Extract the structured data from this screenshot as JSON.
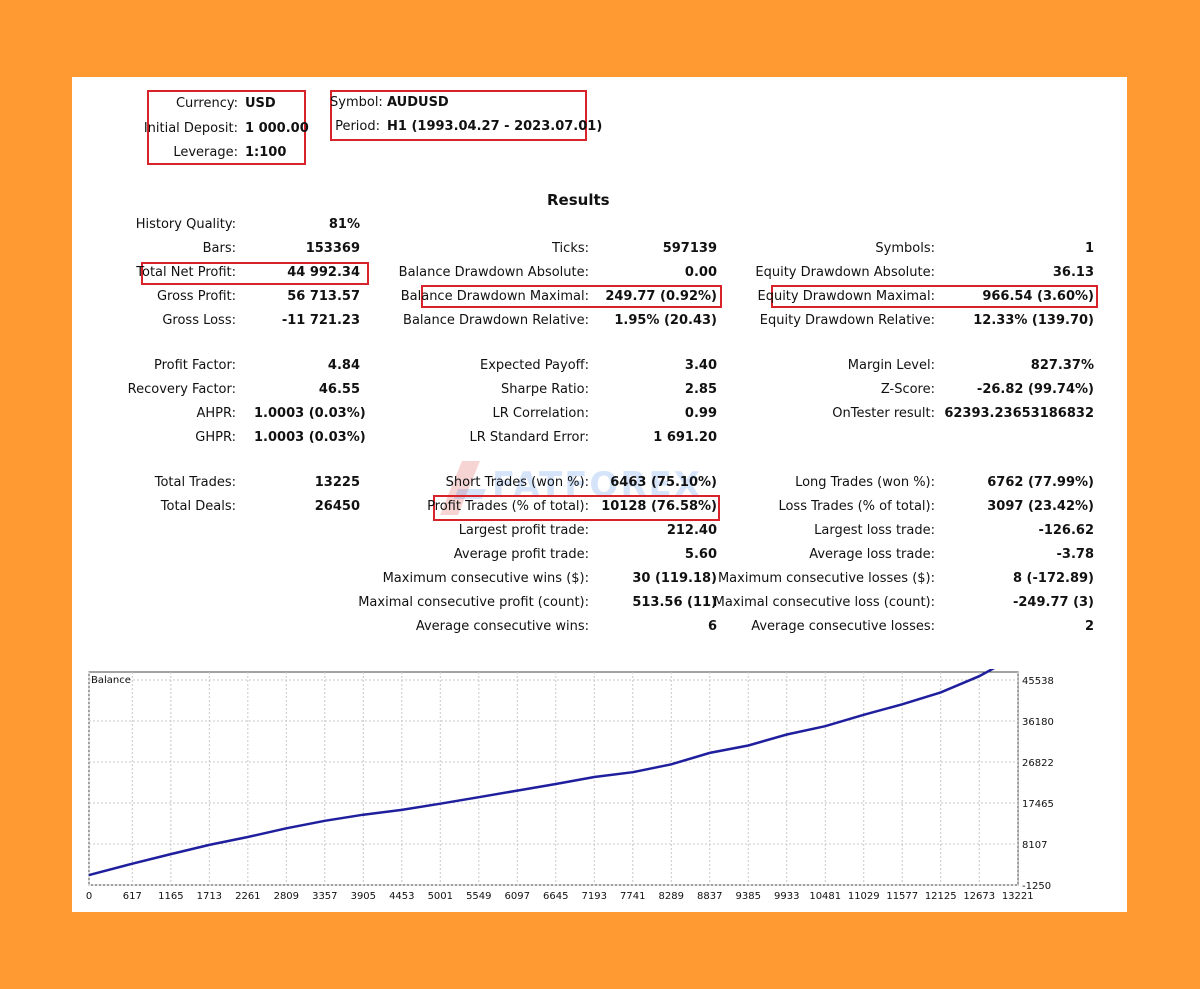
{
  "header": {
    "currency_label": "Currency:",
    "currency": "USD",
    "deposit_label": "Initial Deposit:",
    "deposit": "1 000.00",
    "leverage_label": "Leverage:",
    "leverage": "1:100",
    "symbol_label": "Symbol:",
    "symbol": "AUDUSD",
    "period_label": "Period:",
    "period": "H1 (1993.04.27 - 2023.07.01)"
  },
  "results_title": "Results",
  "col1": [
    {
      "label": "History Quality:",
      "value": "81%"
    },
    {
      "label": "Bars:",
      "value": "153369"
    },
    {
      "label": "Total Net Profit:",
      "value": "44 992.34"
    },
    {
      "label": "Gross Profit:",
      "value": "56 713.57"
    },
    {
      "label": "Gross Loss:",
      "value": "-11 721.23"
    },
    {
      "label": "Profit Factor:",
      "value": "4.84"
    },
    {
      "label": "Recovery Factor:",
      "value": "46.55"
    },
    {
      "label": "AHPR:",
      "value": "1.0003 (0.03%)"
    },
    {
      "label": "GHPR:",
      "value": "1.0003 (0.03%)"
    },
    {
      "label": "Total Trades:",
      "value": "13225"
    },
    {
      "label": "Total Deals:",
      "value": "26450"
    }
  ],
  "col2": [
    {
      "label": "Ticks:",
      "value": "597139"
    },
    {
      "label": "Balance Drawdown Absolute:",
      "value": "0.00"
    },
    {
      "label": "Balance Drawdown Maximal:",
      "value": "249.77 (0.92%)"
    },
    {
      "label": "Balance Drawdown Relative:",
      "value": "1.95% (20.43)"
    },
    {
      "label": "Expected Payoff:",
      "value": "3.40"
    },
    {
      "label": "Sharpe Ratio:",
      "value": "2.85"
    },
    {
      "label": "LR Correlation:",
      "value": "0.99"
    },
    {
      "label": "LR Standard Error:",
      "value": "1 691.20"
    },
    {
      "label": "Short Trades (won %):",
      "value": "6463 (75.10%)"
    },
    {
      "label": "Profit Trades (% of total):",
      "value": "10128 (76.58%)"
    },
    {
      "label": "Largest profit trade:",
      "value": "212.40"
    },
    {
      "label": "Average profit trade:",
      "value": "5.60"
    },
    {
      "label": "Maximum consecutive wins ($):",
      "value": "30 (119.18)"
    },
    {
      "label": "Maximal consecutive profit (count):",
      "value": "513.56 (11)"
    },
    {
      "label": "Average consecutive wins:",
      "value": "6"
    }
  ],
  "col3": [
    {
      "label": "Symbols:",
      "value": "1"
    },
    {
      "label": "Equity Drawdown Absolute:",
      "value": "36.13"
    },
    {
      "label": "Equity Drawdown Maximal:",
      "value": "966.54 (3.60%)"
    },
    {
      "label": "Equity Drawdown Relative:",
      "value": "12.33% (139.70)"
    },
    {
      "label": "Margin Level:",
      "value": "827.37%"
    },
    {
      "label": "Z-Score:",
      "value": "-26.82 (99.74%)"
    },
    {
      "label": "OnTester result:",
      "value": "62393.23653186832"
    },
    {
      "label": "Long Trades (won %):",
      "value": "6762 (77.99%)"
    },
    {
      "label": "Loss Trades (% of total):",
      "value": "3097 (23.42%)"
    },
    {
      "label": "Largest loss trade:",
      "value": "-126.62"
    },
    {
      "label": "Average loss trade:",
      "value": "-3.78"
    },
    {
      "label": "Maximum consecutive losses ($):",
      "value": "8 (-172.89)"
    },
    {
      "label": "Maximal consecutive loss (count):",
      "value": "-249.77 (3)"
    },
    {
      "label": "Average consecutive losses:",
      "value": "2"
    }
  ],
  "watermark": "FATFOREX",
  "colors": {
    "background": "#ff9a33",
    "highlight": "#d8232a",
    "line": "#1f1f9e",
    "grid": "#c8c8c8"
  },
  "chart_data": {
    "type": "line",
    "title": "Balance",
    "x_ticks": [
      "0",
      "617",
      "1165",
      "1713",
      "2261",
      "2809",
      "3357",
      "3905",
      "4453",
      "5001",
      "5549",
      "6097",
      "6645",
      "7193",
      "7741",
      "8289",
      "8837",
      "9385",
      "9933",
      "10481",
      "11029",
      "11577",
      "12125",
      "12673",
      "13221"
    ],
    "y_ticks": [
      "45538",
      "36180",
      "26822",
      "17465",
      "8107",
      "-1250"
    ],
    "xlim": [
      0,
      13225
    ],
    "ylim": [
      -1250,
      45538
    ],
    "series": [
      {
        "x": [
          0,
          617,
          1165,
          1713,
          2261,
          2809,
          3357,
          3905,
          4453,
          5001,
          5549,
          6097,
          6645,
          7193,
          7741,
          8289,
          8837,
          9385,
          9933,
          10481,
          11029,
          11577,
          12125,
          12673,
          13221,
          13225
        ],
        "y": [
          1000,
          3600,
          5800,
          7900,
          9700,
          11700,
          13400,
          14800,
          15900,
          17300,
          18800,
          20300,
          21800,
          23400,
          24500,
          26300,
          28900,
          30600,
          33100,
          35000,
          37600,
          40000,
          42700,
          46400,
          51200,
          51400
        ]
      }
    ]
  }
}
